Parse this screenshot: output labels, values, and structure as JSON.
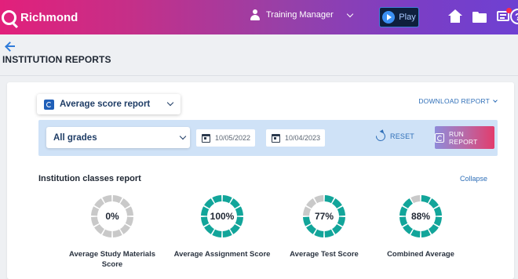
{
  "header": {
    "brand": "Richmond",
    "user_label": "Training Manager",
    "play_label": "Play",
    "icons": [
      "user-icon",
      "home-icon",
      "folder-icon",
      "message-icon",
      "help-icon"
    ],
    "help_glyph": "?"
  },
  "page": {
    "title": "INSTITUTION REPORTS"
  },
  "report": {
    "selected": "Average score report",
    "download_label": "DOWNLOAD REPORT"
  },
  "filters": {
    "grade": "All grades",
    "start_date": "10/05/2022",
    "end_date": "10/04/2023",
    "reset_label": "RESET",
    "run_label": "RUN REPORT"
  },
  "section": {
    "title": "Institution classes report",
    "collapse_label": "Collapse"
  },
  "metrics": [
    {
      "label": "Average Study Materials Score",
      "value_text": "0%",
      "percent": 0
    },
    {
      "label": "Average Assignment Score",
      "value_text": "100%",
      "percent": 100
    },
    {
      "label": "Average Test Score",
      "value_text": "77%",
      "percent": 77
    },
    {
      "label": "Combined Average",
      "value_text": "88%",
      "percent": 88
    }
  ],
  "colors": {
    "accent": "#2f6fb8",
    "ring_fill": "#12a59a",
    "ring_empty": "#c9c9c9",
    "filter_bar": "#cfe2f7"
  }
}
